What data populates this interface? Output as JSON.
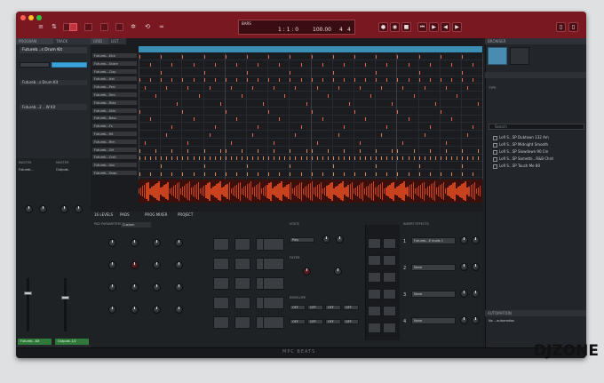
{
  "window": {
    "title": "MPC Beats"
  },
  "transport": {
    "bars_label": "BARS",
    "position": "1 : 1 : 0",
    "tempo": "100.00",
    "sig_a": "4",
    "sig_b": "4"
  },
  "left_panel": {
    "tabs": [
      "PROGRAM",
      "TRACK"
    ],
    "program_name": "Futureb...s Drum Kit",
    "plugin_label": "Futureb...2 ...W Kit",
    "mixer_labels": [
      "MASTER",
      "MASTER"
    ],
    "channel_labels": [
      "Futureb...",
      "Outputs"
    ],
    "bottom_tabs": [
      "Futureb...Kit",
      "Outputs 1/2"
    ]
  },
  "grid": {
    "tabs": [
      "GRID",
      "LIST"
    ],
    "track_names": [
      "Futureb...Kick",
      "Futureb...Snare",
      "Futureb...Clap",
      "Futureb...Hat",
      "Futureb...Perc",
      "Futureb...Tom",
      "Futureb...Ride",
      "Futureb...Shkr",
      "Futureb...Bass",
      "Futureb...Fx",
      "Futureb...Hit",
      "Futureb...Rim",
      "Futureb...OH",
      "Futureb...Crsh",
      "Futureb...Vox",
      "Futureb...Snap"
    ]
  },
  "lower_tabs": [
    "16 LEVELS",
    "PADS",
    "PROG MIXER",
    "PROJECT"
  ],
  "pad_params": {
    "title": "PAD PARAMETERS",
    "kit": "Custom"
  },
  "middle": {
    "voice_label": "VOICE",
    "mode": "Poly",
    "tune_label": "TUNE",
    "filter_label": "FILTER",
    "env_label": "ENVELOPE",
    "values": [
      "OFF",
      "OFF",
      "OFF",
      "OFF",
      "OFF",
      "OFF",
      "OFF",
      "OFF"
    ]
  },
  "fx_slots": {
    "title": "INSERT EFFECTS",
    "slots": [
      {
        "num": "1",
        "name": "Futureb...E mods 1"
      },
      {
        "num": "2",
        "name": "None"
      },
      {
        "num": "3",
        "name": "None"
      },
      {
        "num": "4",
        "name": "None"
      }
    ]
  },
  "browser": {
    "title": "BROWSER",
    "filter_label": "TYPE",
    "search_placeholder": "Search",
    "items": [
      "Lofi S...SP Dubtown 132 Am",
      "Lofi S...SP Midnight Smooth",
      "Lofi S...SP Slowdown 90 Cm",
      "Lofi S...SP Somethi...R&B Chrd",
      "Lofi S...SP Touch Me 80"
    ]
  },
  "automation": {
    "title": "AUTOMATION",
    "text": "No ...automation"
  },
  "footer": {
    "brand": "MPC BEATS"
  },
  "watermark": {
    "text": "DJZONE"
  },
  "colors": {
    "accent": "#7a1822",
    "hit": "#e06a4a",
    "wave": "#c8421d"
  }
}
